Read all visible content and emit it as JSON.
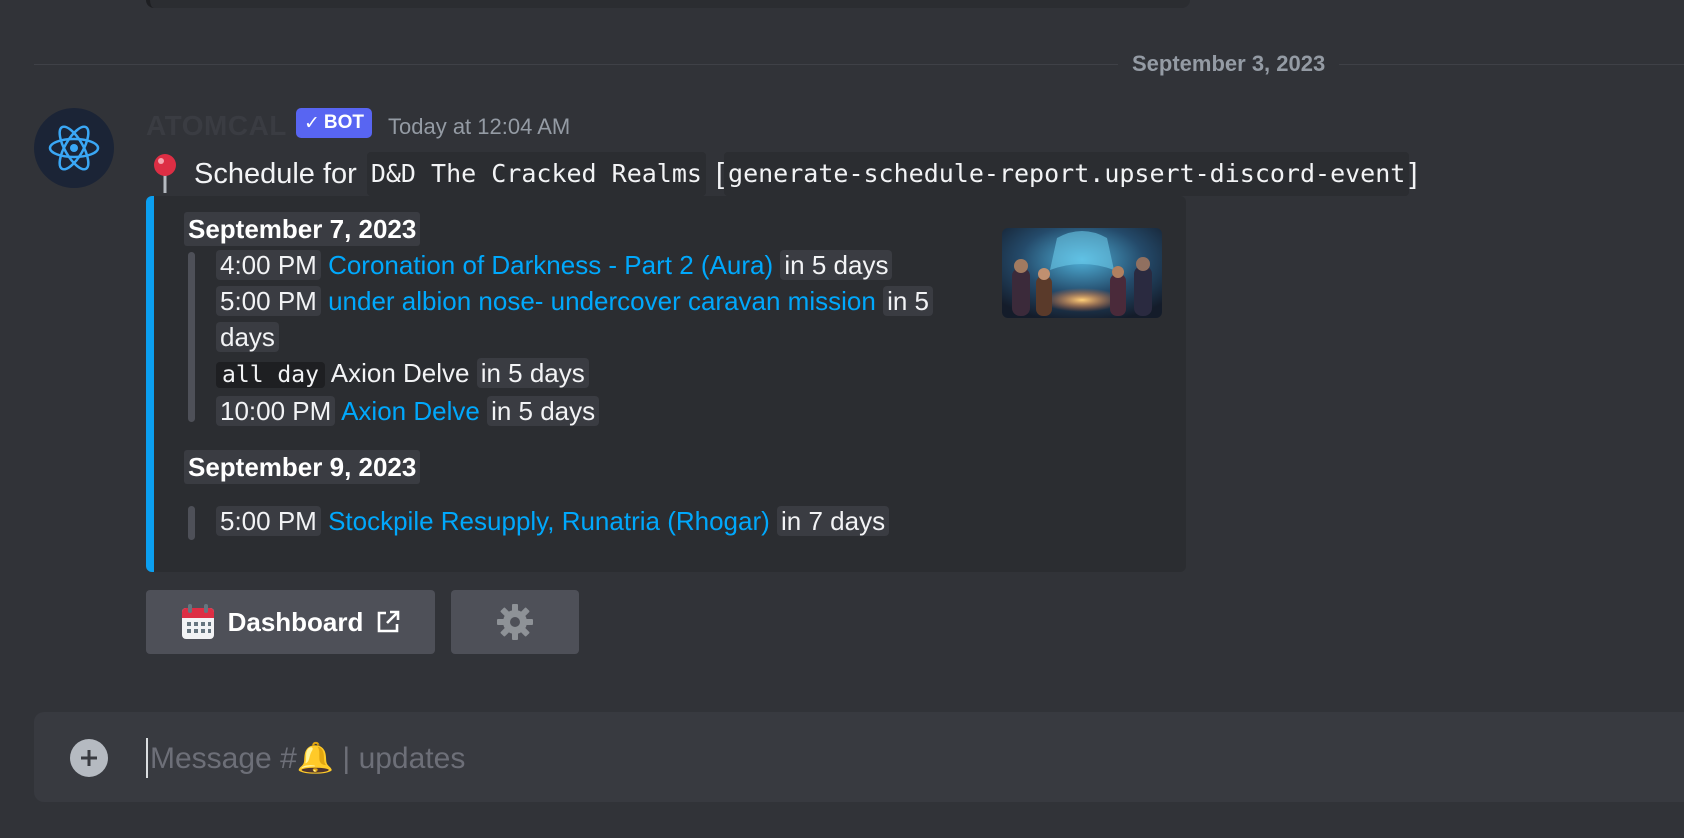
{
  "divider": {
    "date": "September 3, 2023"
  },
  "message": {
    "username": "ATOMCAL",
    "bot_badge": "BOT",
    "timestamp": "Today at 12:04 AM",
    "intro": "Schedule for",
    "schedule_name": "D&D The Cracked Realms",
    "command": "generate-schedule-report.upsert-discord-event",
    "bracket_open": "[",
    "bracket_close": "]"
  },
  "embed": {
    "days": [
      {
        "date": "September 7, 2023",
        "events": [
          {
            "time": "4:00 PM",
            "title": "Coronation of Darkness - Part 2 (Aura)",
            "relative": "in 5 days",
            "linked": true
          },
          {
            "time": "5:00 PM",
            "title": "under albion nose- undercover caravan mission",
            "relative": "in 5",
            "relative_wrap": "days",
            "linked": true
          },
          {
            "time": "all day",
            "title": "Axion Delve",
            "relative": "in 5 days",
            "linked": false
          },
          {
            "time": "10:00 PM",
            "title": "Axion Delve",
            "relative": "in 5 days",
            "linked": true
          }
        ]
      },
      {
        "date": "September 9, 2023",
        "events": [
          {
            "time": "5:00 PM",
            "title": "Stockpile Resupply, Runatria (Rhogar)",
            "relative": "in 7 days",
            "linked": true
          }
        ]
      }
    ]
  },
  "buttons": {
    "dashboard_label": "Dashboard",
    "dashboard_icon": "calendar-icon",
    "settings_icon": "gear-icon"
  },
  "composer": {
    "placeholder": "Message #🔔 | updates"
  },
  "colors": {
    "accent": "#0b9ff0",
    "link": "#00a8fc",
    "bot_badge": "#5865f2",
    "background": "#313338"
  }
}
